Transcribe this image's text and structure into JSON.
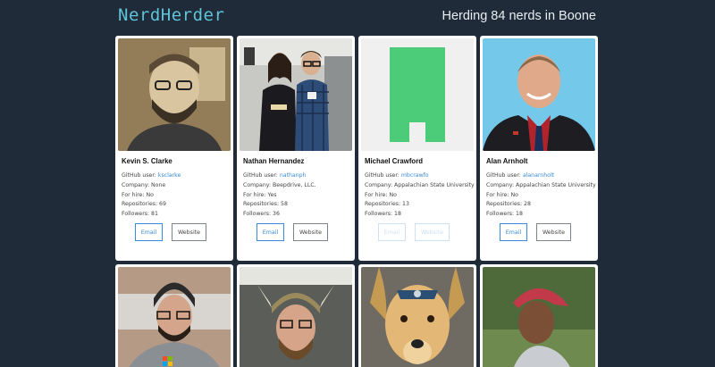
{
  "app": {
    "brand": "NerdHerder",
    "tagline": "Herding 84 nerds in Boone"
  },
  "labels": {
    "github": "GitHub user: ",
    "company": "Company: ",
    "hire": "For hire: ",
    "repos": "Repositories: ",
    "followers": "Followers: ",
    "email": "Email",
    "website": "Website"
  },
  "cards": [
    {
      "name": "Kevin S. Clarke",
      "github": "ksclarke",
      "company": "None",
      "hire": "No",
      "repos": "69",
      "followers": "81",
      "photo_icon": "portrait-bearded-man-sepia"
    },
    {
      "name": "Nathan Hernandez",
      "github": "nathanph",
      "company": "Beepdrive, LLC.",
      "hire": "Yes",
      "repos": "58",
      "followers": "36",
      "photo_icon": "two-people-at-event"
    },
    {
      "name": "Michael Crawford",
      "github": "mbcrawfo",
      "company": "Appalachian State University",
      "hire": "No",
      "repos": "13",
      "followers": "18",
      "photo_icon": "default-identicon-green"
    },
    {
      "name": "Alan Arnholt",
      "github": "alanarnholt",
      "company": "Appalachian State University",
      "hire": "No",
      "repos": "28",
      "followers": "18",
      "photo_icon": "portrait-man-suit-blue-bg"
    }
  ],
  "row2_photos": [
    {
      "photo_icon": "man-beanie-microsoft-shirt"
    },
    {
      "photo_icon": "man-viking-helmet"
    },
    {
      "photo_icon": "yellow-dog"
    },
    {
      "photo_icon": "man-red-cap-outdoors"
    }
  ],
  "colors": {
    "background": "#1f2b38",
    "brand": "#5fc3d9",
    "link": "#3b8ad9",
    "identicon": "#4ccb78"
  }
}
